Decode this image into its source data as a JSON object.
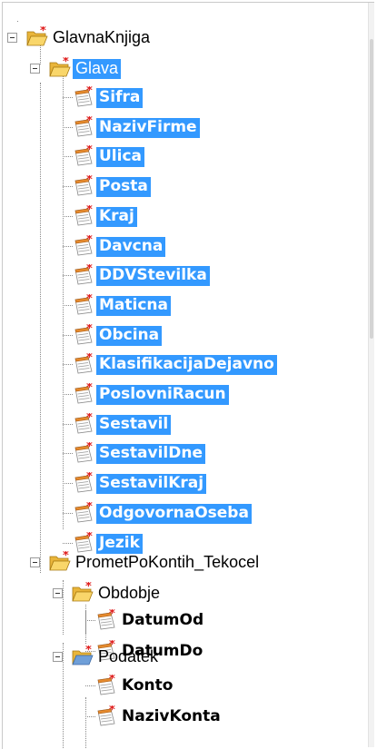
{
  "tree": {
    "root": {
      "label": "GlavnaKnjiga",
      "icon": "folder-open-star-icon"
    },
    "glava": {
      "label": "Glava",
      "icon": "folder-open-star-icon",
      "fields": [
        "Sifra",
        "NazivFirme",
        "Ulica",
        "Posta",
        "Kraj",
        "Davcna",
        "DDVStevilka",
        "Maticna",
        "Obcina",
        "KlasifikacijaDejavno",
        "PoslovniRacun",
        "Sestavil",
        "SestavilDne",
        "SestavilKraj",
        "OdgovornaOseba",
        "Jezik"
      ]
    },
    "promet": {
      "label": "PrometPoKontih_Tekocel",
      "icon": "folder-open-star-icon",
      "obdobje": {
        "label": "Obdobje",
        "fields": [
          "DatumOd",
          "DatumDo"
        ]
      },
      "podatek": {
        "label": "Podatek",
        "icon": "folder-open-blue-star-icon",
        "fields": [
          "Konto",
          "NazivKonta"
        ]
      }
    }
  },
  "colors": {
    "selection": "#3399ff",
    "folder": "#f7c948",
    "star": "#e02020"
  }
}
